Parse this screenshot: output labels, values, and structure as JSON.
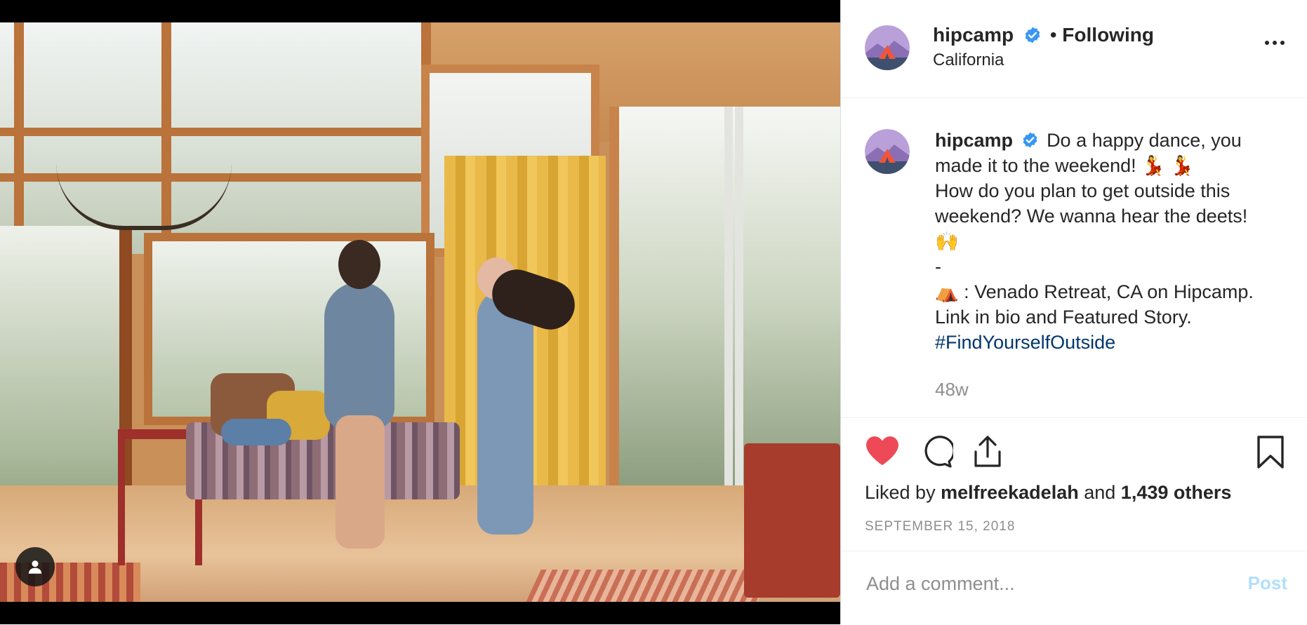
{
  "colors": {
    "verified_blue": "#3897f0",
    "like_red": "#ed4956",
    "link_blue": "#00376b",
    "muted_gray": "#8e8e8e",
    "post_disabled": "#b2dffc"
  },
  "media": {
    "tag_icon": "person-icon"
  },
  "header": {
    "username": "hipcamp",
    "separator": "•",
    "follow_state": "Following",
    "location": "California",
    "more_icon": "ellipsis-icon"
  },
  "caption": {
    "username": "hipcamp",
    "lines": [
      "Do a happy dance, you made it to the weekend! 💃 💃",
      "How do you plan to get outside this weekend? We wanna hear the deets!",
      "🙌",
      "-",
      "⛺ : Venado Retreat, CA on Hipcamp.",
      "Link in bio and Featured Story."
    ],
    "hashtag": "#FindYourselfOutside",
    "age": "48w"
  },
  "actions": {
    "like_icon": "heart-filled-icon",
    "comment_icon": "comment-icon",
    "share_icon": "share-icon",
    "save_icon": "bookmark-icon"
  },
  "likes": {
    "prefix": "Liked by",
    "user": "melfreekadelah",
    "conj": "and",
    "others": "1,439 others"
  },
  "date": "SEPTEMBER 15, 2018",
  "comment": {
    "placeholder": "Add a comment...",
    "post_label": "Post"
  }
}
